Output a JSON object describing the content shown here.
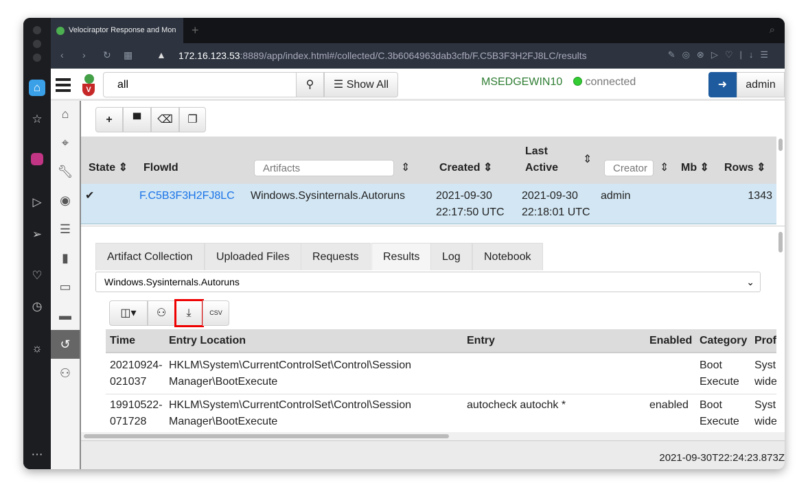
{
  "browser": {
    "tab_title": "Velociraptor Response and Mon",
    "url_host": "172.16.123.53",
    "url_rest": ":8889/app/index.html#/collected/C.3b6064963dab3cfb/F.C5B3F3H2FJ8LC/results"
  },
  "header": {
    "search_value": "all",
    "show_all": "Show All",
    "hostname": "MSEDGEWIN10",
    "status": "connected",
    "user": "admin"
  },
  "flows": {
    "columns": {
      "state": "State",
      "flowid": "FlowId",
      "artifacts_placeholder": "Artifacts",
      "created": "Created",
      "last": "Last",
      "active": "Active",
      "creator_placeholder": "Creator",
      "mb": "Mb",
      "rows": "Rows"
    },
    "rows": [
      {
        "flowid": "F.C5B3F3H2FJ8LC",
        "artifact": "Windows.Sysinternals.Autoruns",
        "created_date": "2021-09-30",
        "created_time": "22:17:50 UTC",
        "last_date": "2021-09-30",
        "last_time": "22:18:01 UTC",
        "creator": "admin",
        "rows": "1343"
      }
    ]
  },
  "detail": {
    "tabs": [
      "Artifact Collection",
      "Uploaded Files",
      "Requests",
      "Results",
      "Log",
      "Notebook"
    ],
    "active_tab": "Results",
    "artifact_select": "Windows.Sysinternals.Autoruns",
    "columns": [
      "Time",
      "Entry Location",
      "Entry",
      "Enabled",
      "Category",
      "Prof"
    ],
    "rows": [
      {
        "time1": "20210924-",
        "time2": "021037",
        "loc1": "HKLM\\System\\CurrentControlSet\\Control\\Session",
        "loc2": "Manager\\BootExecute",
        "entry": "",
        "enabled": "",
        "cat1": "Boot",
        "cat2": "Execute",
        "prof1": "Syst",
        "prof2": "wide"
      },
      {
        "time1": "19910522-",
        "time2": "071728",
        "loc1": "HKLM\\System\\CurrentControlSet\\Control\\Session",
        "loc2": "Manager\\BootExecute",
        "entry": "autocheck autochk *",
        "enabled": "enabled",
        "cat1": "Boot",
        "cat2": "Execute",
        "prof1": "Syst",
        "prof2": "wide"
      }
    ]
  },
  "footer": {
    "timestamp": "2021-09-30T22:24:23.873Z"
  },
  "colors": {
    "accent": "#1e5b9e",
    "selected_row": "#d2e6f3",
    "host": "#2e7d32"
  }
}
